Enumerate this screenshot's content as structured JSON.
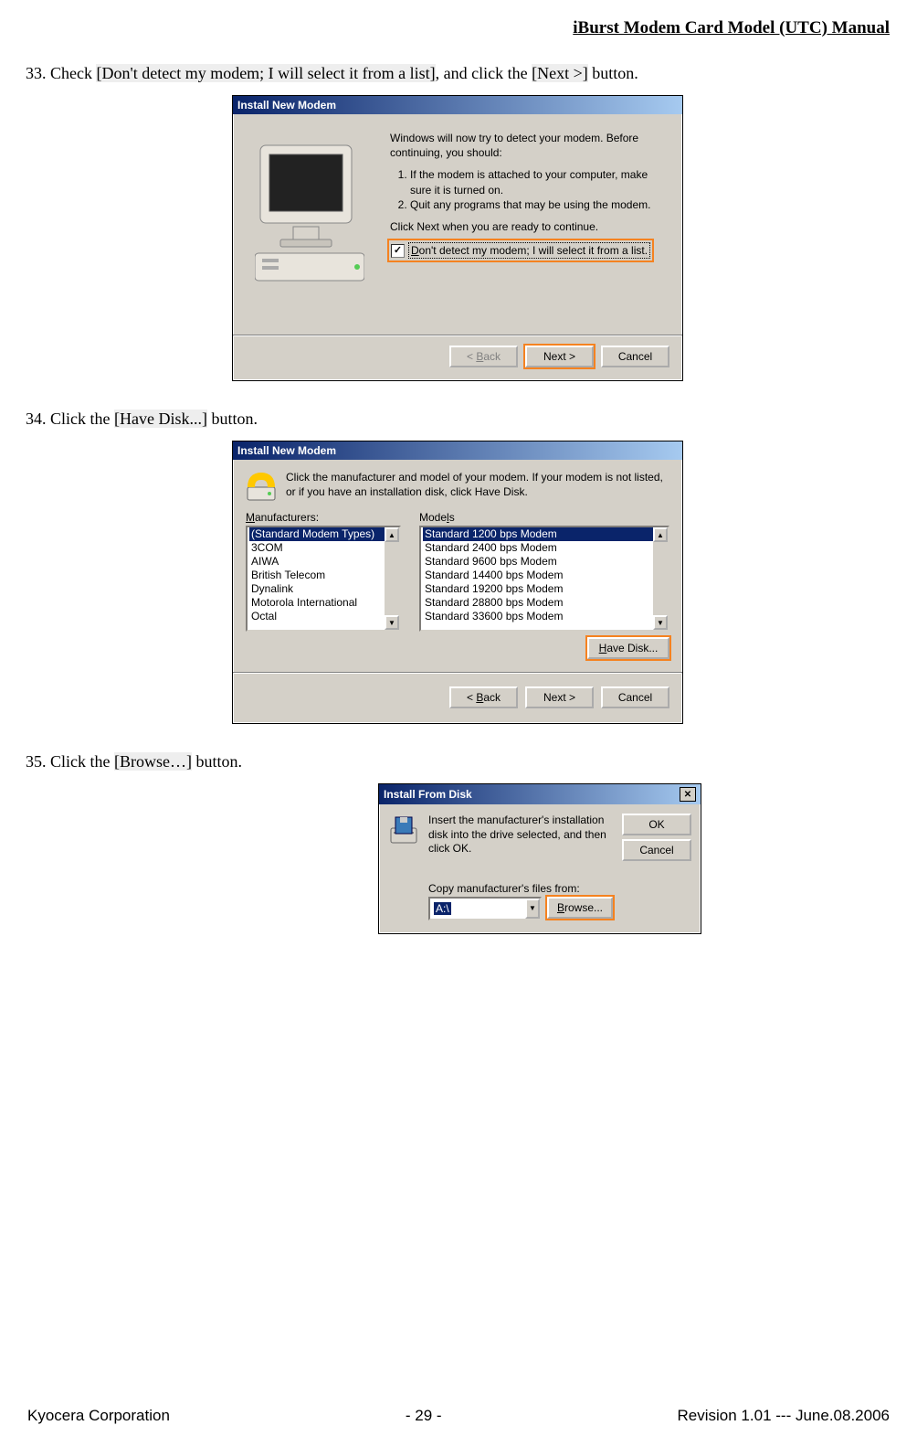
{
  "header": "iBurst  Modem  Card  Model  (UTC)  Manual ",
  "step33": {
    "num": "33. Check ",
    "ref1": "[Don't detect my modem; I will select it from a list]",
    "mid": ", and click the ",
    "ref2": "[Next >]",
    "end": " button."
  },
  "shot1": {
    "title": "Install New Modem",
    "intro": "Windows will now try to detect your modem.  Before continuing, you should:",
    "li1": "If the modem is attached to your computer, make sure it is turned on.",
    "li2": "Quit any programs that may be using the modem.",
    "cont": "Click Next when you are ready to continue.",
    "checkbox_label": "Don't detect my modem; I will select it from a list.",
    "back": "< Back",
    "next": "Next >",
    "cancel": "Cancel"
  },
  "step34": {
    "num": "34. Click the ",
    "ref1": "[Have Disk...]",
    "end": " button."
  },
  "shot2": {
    "title": "Install New Modem",
    "desc": "Click the manufacturer and model of your modem. If your modem is not listed, or if you have an installation disk, click Have Disk.",
    "mfr_label": "Manufacturers:",
    "models_label": "Models",
    "manufacturers": [
      "(Standard Modem Types)",
      "3COM",
      "AIWA",
      "British Telecom",
      "Dynalink",
      "Motorola International",
      "Octal"
    ],
    "models": [
      "Standard  1200 bps Modem",
      "Standard  2400 bps Modem",
      "Standard  9600 bps Modem",
      "Standard 14400 bps Modem",
      "Standard 19200 bps Modem",
      "Standard 28800 bps Modem",
      "Standard 33600 bps Modem"
    ],
    "have_disk": "Have Disk...",
    "back": "< Back",
    "next": "Next >",
    "cancel": "Cancel"
  },
  "step35": {
    "num": "35. Click the ",
    "ref1": "[Browse…]",
    "end": " button."
  },
  "shot3": {
    "title": "Install From Disk",
    "desc": "Insert the manufacturer's installation disk into the drive selected, and then click OK.",
    "ok": "OK",
    "cancel": "Cancel",
    "copy_label": "Copy manufacturer's files from:",
    "path": "A:\\",
    "browse": "Browse..."
  },
  "footer": {
    "left": "Kyocera Corporation",
    "center": "- 29 -",
    "right": "Revision 1.01 --- June.08.2006"
  }
}
